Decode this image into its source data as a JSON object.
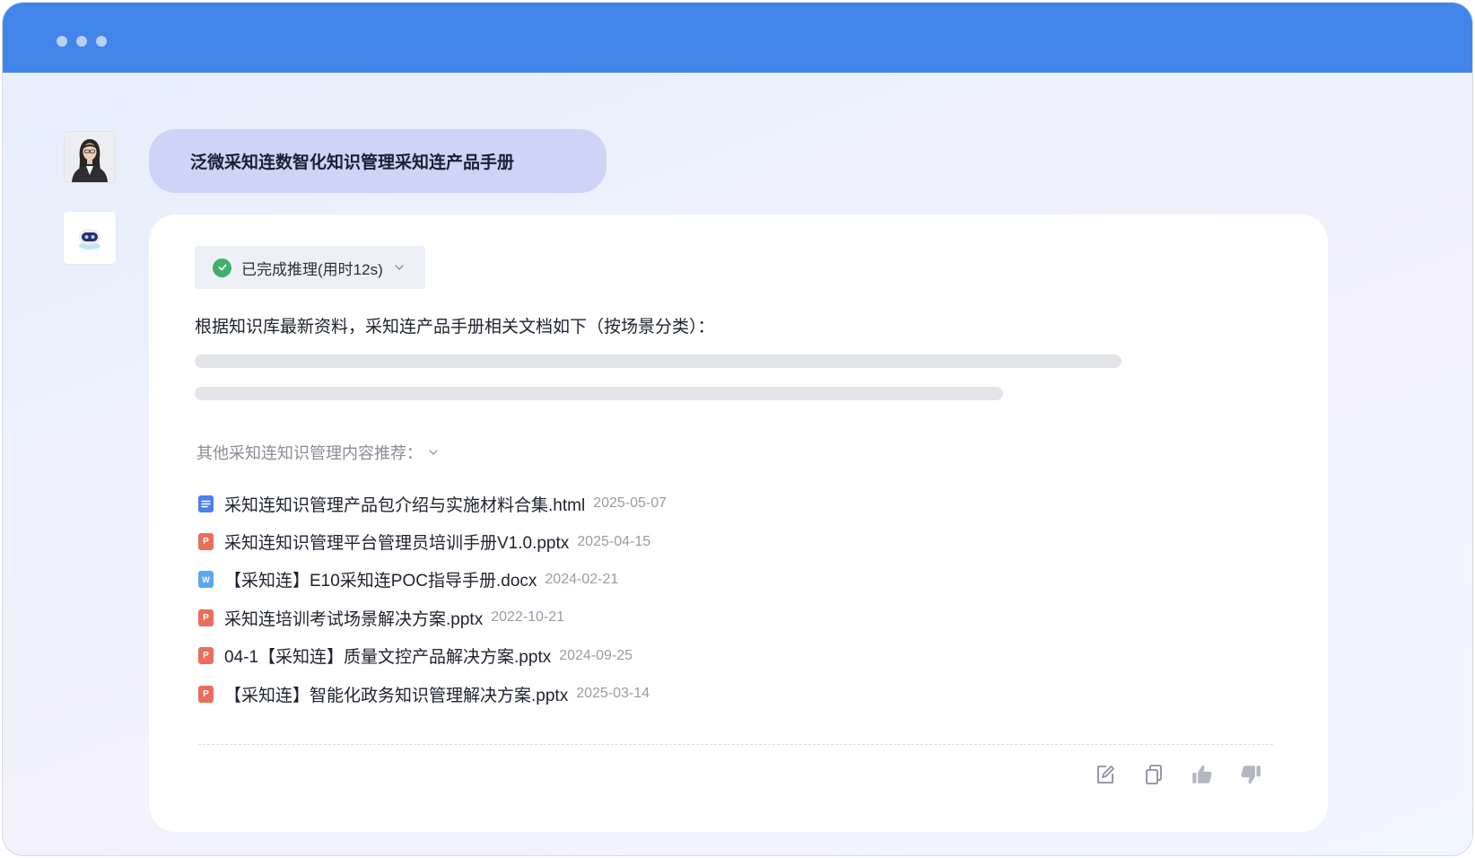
{
  "question": "泛微采知连数智化知识管理采知连产品手册",
  "reasoning": {
    "label": "已完成推理(用时12s)",
    "status_color": "#3fb16b"
  },
  "answer": {
    "intro": "根据知识库最新资料，采知连产品手册相关文档如下（按场景分类）："
  },
  "recommend": {
    "label": "其他采知连知识管理内容推荐：",
    "documents": [
      {
        "name": "采知连知识管理产品包介绍与实施材料合集.html",
        "date": "2025-05-07",
        "type": "html",
        "icon_text": ""
      },
      {
        "name": "采知连知识管理平台管理员培训手册V1.0.pptx",
        "date": "2025-04-15",
        "type": "pptx",
        "icon_text": "P"
      },
      {
        "name": "【采知连】E10采知连POC指导手册.docx",
        "date": "2024-02-21",
        "type": "docx",
        "icon_text": "W"
      },
      {
        "name": "采知连培训考试场景解决方案.pptx",
        "date": "2022-10-21",
        "type": "pptx",
        "icon_text": "P"
      },
      {
        "name": "04-1【采知连】质量文控产品解决方案.pptx",
        "date": "2024-09-25",
        "type": "pptx",
        "icon_text": "P"
      },
      {
        "name": "【采知连】智能化政务知识管理解决方案.pptx",
        "date": "2025-03-14",
        "type": "pptx",
        "icon_text": "P"
      }
    ]
  },
  "actions": [
    {
      "name": "edit-icon"
    },
    {
      "name": "copy-icon"
    },
    {
      "name": "thumbs-up-icon"
    },
    {
      "name": "thumbs-down-icon"
    }
  ],
  "colors": {
    "titlebar": "#4285ea",
    "user_bubble": "#ced4f8",
    "html_icon": "#4a7ff0",
    "pptx_icon": "#eb6d5b",
    "docx_icon": "#5aa7f0"
  }
}
